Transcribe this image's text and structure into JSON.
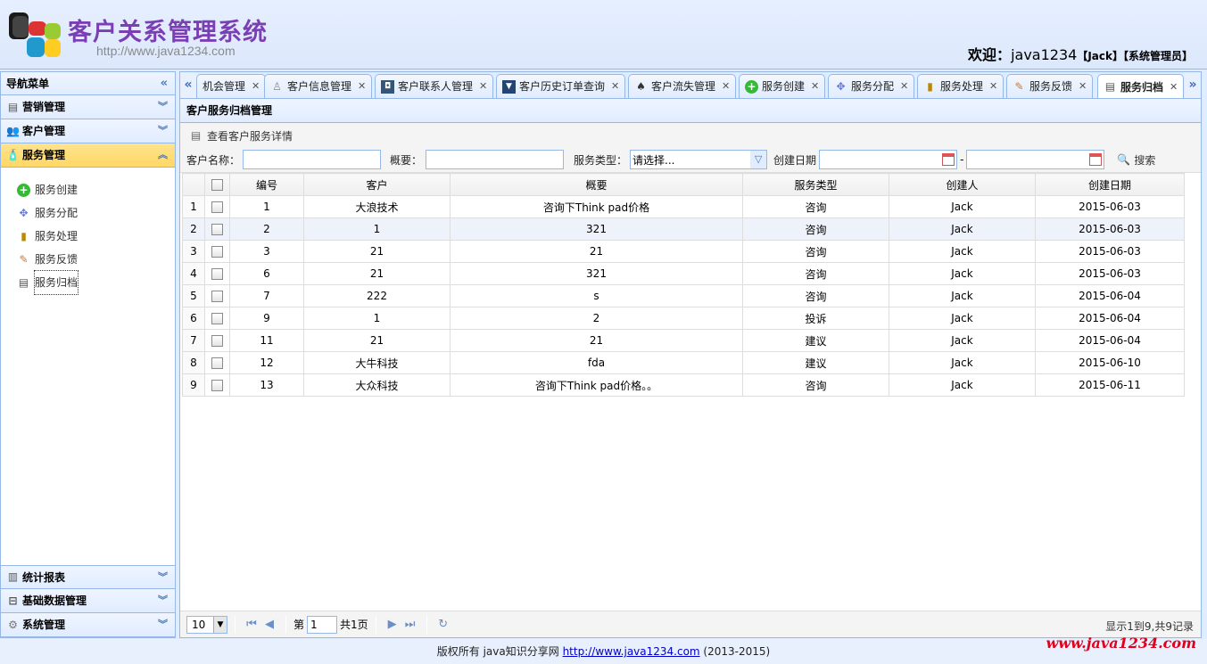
{
  "header": {
    "title": "客户关系管理系统",
    "url": "http://www.java1234.com",
    "welcome_prefix": "欢迎：",
    "username": "java1234",
    "name_tag": "【Jack】",
    "role_tag": "【系统管理员】"
  },
  "sidebar": {
    "title": "导航菜单",
    "sections": [
      {
        "label": "营销管理",
        "icon": "marketing-icon"
      },
      {
        "label": "客户管理",
        "icon": "customer-icon"
      },
      {
        "label": "服务管理",
        "icon": "service-icon"
      }
    ],
    "bottom_sections": [
      {
        "label": "统计报表",
        "icon": "report-icon"
      },
      {
        "label": "基础数据管理",
        "icon": "database-icon"
      },
      {
        "label": "系统管理",
        "icon": "gear-icon"
      }
    ],
    "service_items": [
      {
        "label": "服务创建",
        "icon": "add-circle-icon"
      },
      {
        "label": "服务分配",
        "icon": "move-icon"
      },
      {
        "label": "服务处理",
        "icon": "bottle-icon"
      },
      {
        "label": "服务反馈",
        "icon": "pen-icon"
      },
      {
        "label": "服务归档",
        "icon": "document-icon"
      }
    ]
  },
  "tabs": [
    {
      "label": "机会管理"
    },
    {
      "label": "客户信息管理"
    },
    {
      "label": "客户联系人管理"
    },
    {
      "label": "客户历史订单查询"
    },
    {
      "label": "客户流失管理"
    },
    {
      "label": "服务创建"
    },
    {
      "label": "服务分配"
    },
    {
      "label": "服务处理"
    },
    {
      "label": "服务反馈"
    },
    {
      "label": "服务归档"
    }
  ],
  "panel": {
    "title": "客户服务归档管理",
    "detail_button": "查看客户服务详情",
    "search": {
      "customer_label": "客户名称：",
      "customer_value": "",
      "summary_label": "概要：",
      "summary_value": "",
      "type_label": "服务类型：",
      "type_value": "请选择...",
      "date_label": "创建日期",
      "date_sep": "-",
      "search_button": "搜索"
    }
  },
  "grid": {
    "columns": [
      "编号",
      "客户",
      "概要",
      "服务类型",
      "创建人",
      "创建日期"
    ],
    "rows": [
      {
        "rn": "1",
        "id": "1",
        "customer": "大浪技术",
        "summary": "咨询下Think pad价格",
        "type": "咨询",
        "creator": "Jack",
        "date": "2015-06-03"
      },
      {
        "rn": "2",
        "id": "2",
        "customer": "1",
        "summary": "321",
        "type": "咨询",
        "creator": "Jack",
        "date": "2015-06-03"
      },
      {
        "rn": "3",
        "id": "3",
        "customer": "21",
        "summary": "21",
        "type": "咨询",
        "creator": "Jack",
        "date": "2015-06-03"
      },
      {
        "rn": "4",
        "id": "6",
        "customer": "21",
        "summary": "321",
        "type": "咨询",
        "creator": "Jack",
        "date": "2015-06-03"
      },
      {
        "rn": "5",
        "id": "7",
        "customer": "222",
        "summary": "s",
        "type": "咨询",
        "creator": "Jack",
        "date": "2015-06-04"
      },
      {
        "rn": "6",
        "id": "9",
        "customer": "1",
        "summary": "2",
        "type": "投诉",
        "creator": "Jack",
        "date": "2015-06-04"
      },
      {
        "rn": "7",
        "id": "11",
        "customer": "21",
        "summary": "21",
        "type": "建议",
        "creator": "Jack",
        "date": "2015-06-04"
      },
      {
        "rn": "8",
        "id": "12",
        "customer": "大牛科技",
        "summary": "fda",
        "type": "建议",
        "creator": "Jack",
        "date": "2015-06-10"
      },
      {
        "rn": "9",
        "id": "13",
        "customer": "大众科技",
        "summary": "咨询下Think pad价格。。",
        "type": "咨询",
        "creator": "Jack",
        "date": "2015-06-11"
      }
    ]
  },
  "pager": {
    "page_size": "10",
    "page_prefix": "第",
    "page_value": "1",
    "page_total": "共1页",
    "info": "显示1到9,共9记录"
  },
  "footer": {
    "text": "版权所有 java知识分享网 ",
    "link": "http://www.java1234.com",
    "years": " (2013-2015)",
    "watermark": "www.java1234.com"
  }
}
